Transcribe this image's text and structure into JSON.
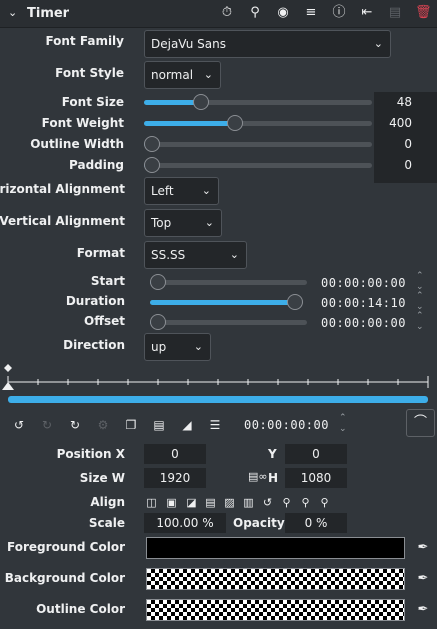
{
  "header": {
    "title": "Timer",
    "icons": [
      "collapse-chevron",
      "timer-icon",
      "zoom-icon",
      "eye-icon",
      "sliders-icon",
      "info-icon",
      "list-icon",
      "disabled-icon",
      "trash-icon"
    ]
  },
  "font_family": {
    "label": "Font Family",
    "value": "DejaVu Sans"
  },
  "font_style": {
    "label": "Font Style",
    "value": "normal"
  },
  "font_size": {
    "label": "Font Size",
    "value": "48",
    "fraction": 0.23
  },
  "font_weight": {
    "label": "Font Weight",
    "value": "400",
    "fraction": 0.39
  },
  "outline_width": {
    "label": "Outline Width",
    "value": "0",
    "fraction": 0.0
  },
  "padding": {
    "label": "Padding",
    "value": "0",
    "fraction": 0.0
  },
  "horizontal_alignment": {
    "label": "Horizontal Alignment",
    "value": "Left"
  },
  "vertical_alignment": {
    "label": "Vertical Alignment",
    "value": "Top"
  },
  "format": {
    "label": "Format",
    "value": "SS.SS"
  },
  "start": {
    "label": "Start",
    "value": "00:00:00:00",
    "fraction": 0.0
  },
  "duration": {
    "label": "Duration",
    "value": "00:00:14:10",
    "fraction": 1.0
  },
  "offset": {
    "label": "Offset",
    "value": "00:00:00:00",
    "fraction": 0.0
  },
  "direction": {
    "label": "Direction",
    "value": "up"
  },
  "timeline": {
    "timecode": "00:00:00:00"
  },
  "position": {
    "label": "Position X",
    "x": "0",
    "y_label": "Y",
    "y": "0"
  },
  "size": {
    "label": "Size W",
    "w": "1920",
    "h_label": "H",
    "h": "1080"
  },
  "align": {
    "label": "Align"
  },
  "scale": {
    "label": "Scale",
    "value": "100.00 %",
    "opacity_label": "Opacity",
    "opacity": "0 %"
  },
  "foreground_color": {
    "label": "Foreground Color",
    "color": "#000000"
  },
  "background_color": {
    "label": "Background Color"
  },
  "outline_color": {
    "label": "Outline Color"
  },
  "colors": {
    "accent": "#3daee9",
    "background": "#31363b",
    "danger": "#da4453"
  }
}
